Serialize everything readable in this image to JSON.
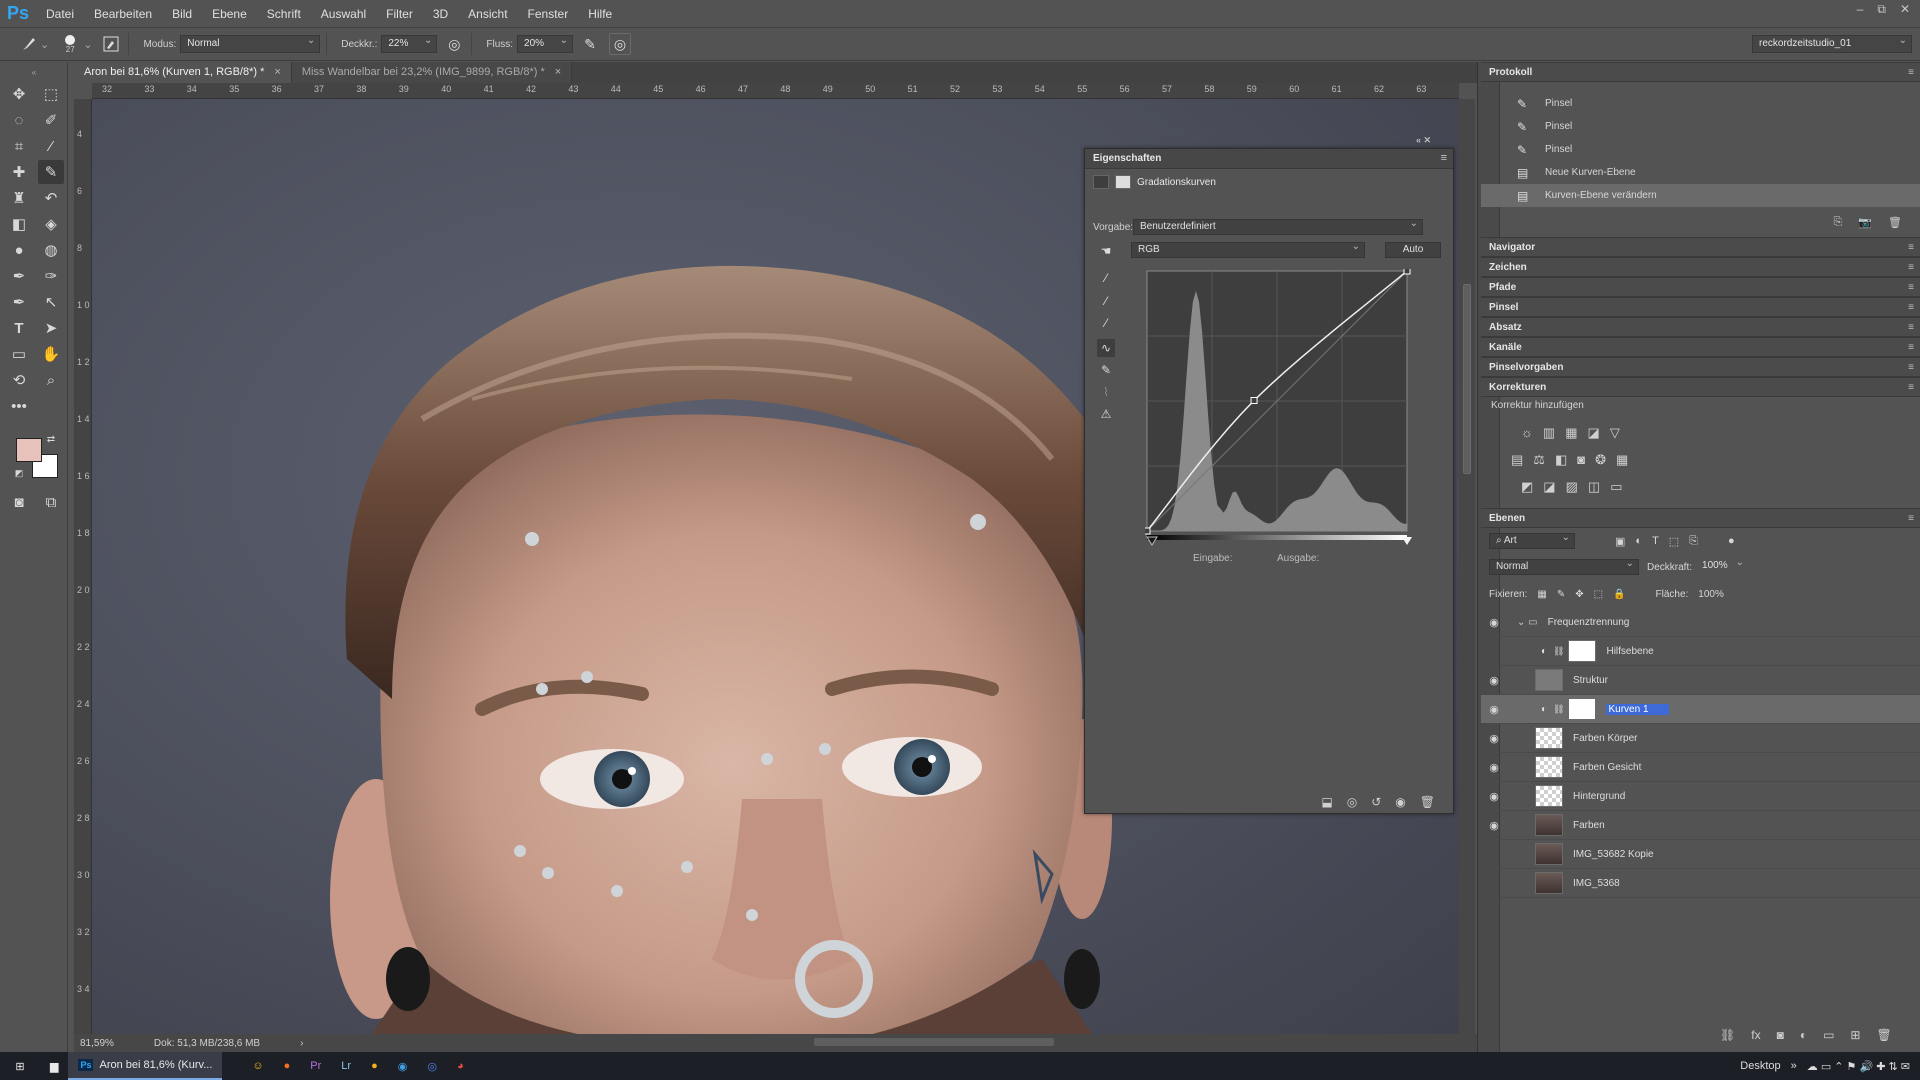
{
  "app": {
    "logo": "Ps"
  },
  "menu": [
    "Datei",
    "Bearbeiten",
    "Bild",
    "Ebene",
    "Schrift",
    "Auswahl",
    "Filter",
    "3D",
    "Ansicht",
    "Fenster",
    "Hilfe"
  ],
  "window_controls": {
    "minimize": "–",
    "restore": "⧉",
    "close": "✕"
  },
  "options": {
    "brush_size": "27",
    "mode_label": "Modus:",
    "mode_value": "Normal",
    "opacity_label": "Deckkr.:",
    "opacity_value": "22%",
    "flow_label": "Fluss:",
    "flow_value": "20%",
    "workspace": "reckordzeitstudio_01"
  },
  "doc_tabs": [
    {
      "label": "Aron bei 81,6% (Kurven 1, RGB/8*) *",
      "close": "×",
      "active": true
    },
    {
      "label": "Miss Wandelbar bei 23,2% (IMG_9899, RGB/8*) *",
      "close": "×",
      "active": false
    }
  ],
  "ruler_top": [
    "32",
    "33",
    "34",
    "35",
    "36",
    "37",
    "38",
    "39",
    "40",
    "41",
    "42",
    "43",
    "44",
    "45",
    "46",
    "47",
    "48",
    "49",
    "50",
    "51",
    "52",
    "53",
    "54",
    "55",
    "56",
    "57",
    "58",
    "59",
    "60",
    "61",
    "62",
    "63"
  ],
  "ruler_left": [
    "4",
    "6",
    "8",
    "1 0",
    "1 2",
    "1 4",
    "1 6",
    "1 8",
    "2 0",
    "2 2",
    "2 4",
    "2 6",
    "2 8",
    "3 0",
    "3 2",
    "3 4"
  ],
  "status": {
    "zoom": "81,59%",
    "doc": "Dok: 51,3 MB/238,6 MB",
    "arrow": "›"
  },
  "properties": {
    "header": "Eigenschaften",
    "title": "Gradationskurven",
    "preset_label": "Vorgabe:",
    "preset_value": "Benutzerdefiniert",
    "channel_value": "RGB",
    "auto_label": "Auto",
    "input_label": "Eingabe:",
    "output_label": "Ausgabe:"
  },
  "curve": {
    "points": [
      [
        0,
        0
      ],
      [
        105,
        128
      ],
      [
        255,
        255
      ]
    ],
    "histogram": "two-peak"
  },
  "panels": {
    "protokoll": "Protokoll",
    "history": [
      {
        "label": "Pinsel",
        "icon": "brush-icon",
        "selected": false
      },
      {
        "label": "Pinsel",
        "icon": "brush-icon",
        "selected": false
      },
      {
        "label": "Pinsel",
        "icon": "brush-icon",
        "selected": false
      },
      {
        "label": "Neue Kurven-Ebene",
        "icon": "doc-icon",
        "selected": false
      },
      {
        "label": "Kurven-Ebene verändern",
        "icon": "doc-icon",
        "selected": true
      }
    ],
    "collapsed": [
      "Navigator",
      "Zeichen",
      "Pfade",
      "Pinsel",
      "Absatz",
      "Kanäle",
      "Pinselvorgaben",
      "Korrekturen"
    ],
    "korrektur_hinzufuegen": "Korrektur hinzufügen",
    "ebenen": "Ebenen"
  },
  "layers_options": {
    "kind": "Art",
    "blend": "Normal",
    "opacity_label": "Deckkraft:",
    "opacity_value": "100%",
    "lock_label": "Fixieren:",
    "fill_label": "Fläche:",
    "fill_value": "100%"
  },
  "layers": [
    {
      "name": "Frequenztrennung",
      "visible": true,
      "type": "group"
    },
    {
      "name": "Hilfsebene",
      "visible": false,
      "type": "adjust"
    },
    {
      "name": "Struktur",
      "visible": true,
      "type": "grey"
    },
    {
      "name": "Kurven 1",
      "visible": true,
      "type": "adjust",
      "selected": true
    },
    {
      "name": "Farben Körper",
      "visible": true,
      "type": "checker"
    },
    {
      "name": "Farben Gesicht",
      "visible": true,
      "type": "checker"
    },
    {
      "name": "Hintergrund",
      "visible": true,
      "type": "checker"
    },
    {
      "name": "Farben",
      "visible": true,
      "type": "photo"
    },
    {
      "name": "IMG_53682 Kopie",
      "visible": false,
      "type": "photo"
    },
    {
      "name": "IMG_5368",
      "visible": false,
      "type": "photo"
    }
  ],
  "taskbar": {
    "active_app": "Aron bei 81,6% (Kurv...",
    "desktop": "Desktop"
  },
  "colors": {
    "foreground": "#e6c2bb",
    "background": "#ffffff",
    "accent": "#33a7f5"
  }
}
